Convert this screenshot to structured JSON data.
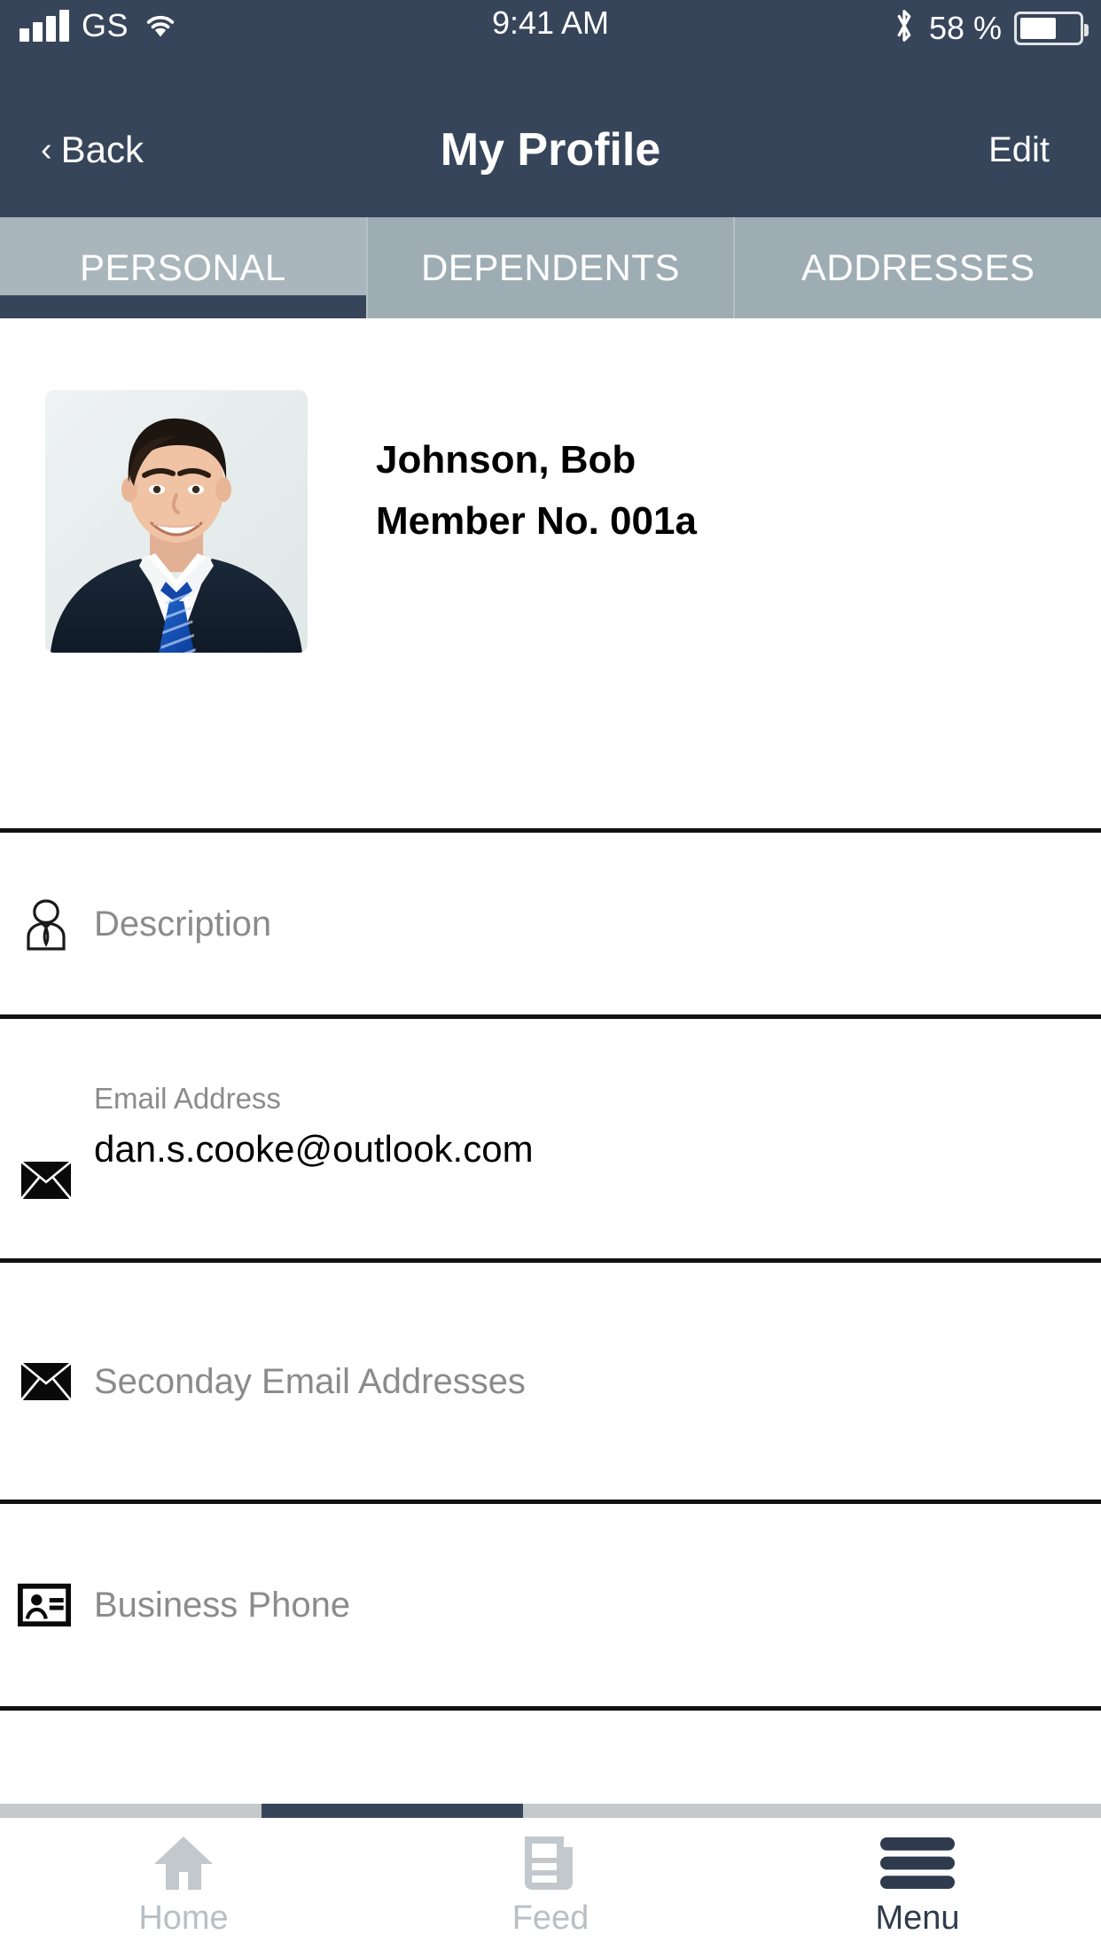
{
  "status_bar": {
    "carrier": "GS",
    "time": "9:41 AM",
    "battery_percent": "58 %",
    "signal_icon": "signal-bars-icon",
    "wifi_icon": "wifi-icon",
    "bluetooth_icon": "bluetooth-icon",
    "battery_icon": "battery-icon"
  },
  "nav": {
    "back_label": "Back",
    "back_chevron": "‹",
    "title": "My Profile",
    "edit_label": "Edit"
  },
  "tabs": [
    {
      "label": "PERSONAL",
      "active": true
    },
    {
      "label": "DEPENDENTS",
      "active": false
    },
    {
      "label": "ADDRESSES",
      "active": false
    }
  ],
  "profile": {
    "photo_alt": "profile-photo",
    "name": "Johnson, Bob",
    "member_no": "Member No. 001a"
  },
  "fields": [
    {
      "icon": "person-tie-icon",
      "placeholder": "Description",
      "label": "",
      "value": ""
    },
    {
      "icon": "envelope-icon",
      "placeholder": "",
      "label": "Email Address",
      "value": "dan.s.cooke@outlook.com"
    },
    {
      "icon": "envelope-icon",
      "placeholder": "Seconday Email Addresses",
      "label": "",
      "value": ""
    },
    {
      "icon": "contact-card-icon",
      "placeholder": "Business Phone",
      "label": "",
      "value": ""
    }
  ],
  "bottom_nav": [
    {
      "label": "Home",
      "icon": "home-icon",
      "active": false
    },
    {
      "label": "Feed",
      "icon": "feed-icon",
      "active": false
    },
    {
      "label": "Menu",
      "icon": "hamburger-menu-icon",
      "active": true
    }
  ],
  "colors": {
    "navbar": "#36455a",
    "tabbar": "#9eadb3",
    "tab_active_indicator": "#36455a",
    "placeholder_text": "#8b8b8b",
    "value_text": "#000000",
    "inactive_bottom": "#b9bfc4",
    "active_bottom": "#2f3b4d"
  }
}
